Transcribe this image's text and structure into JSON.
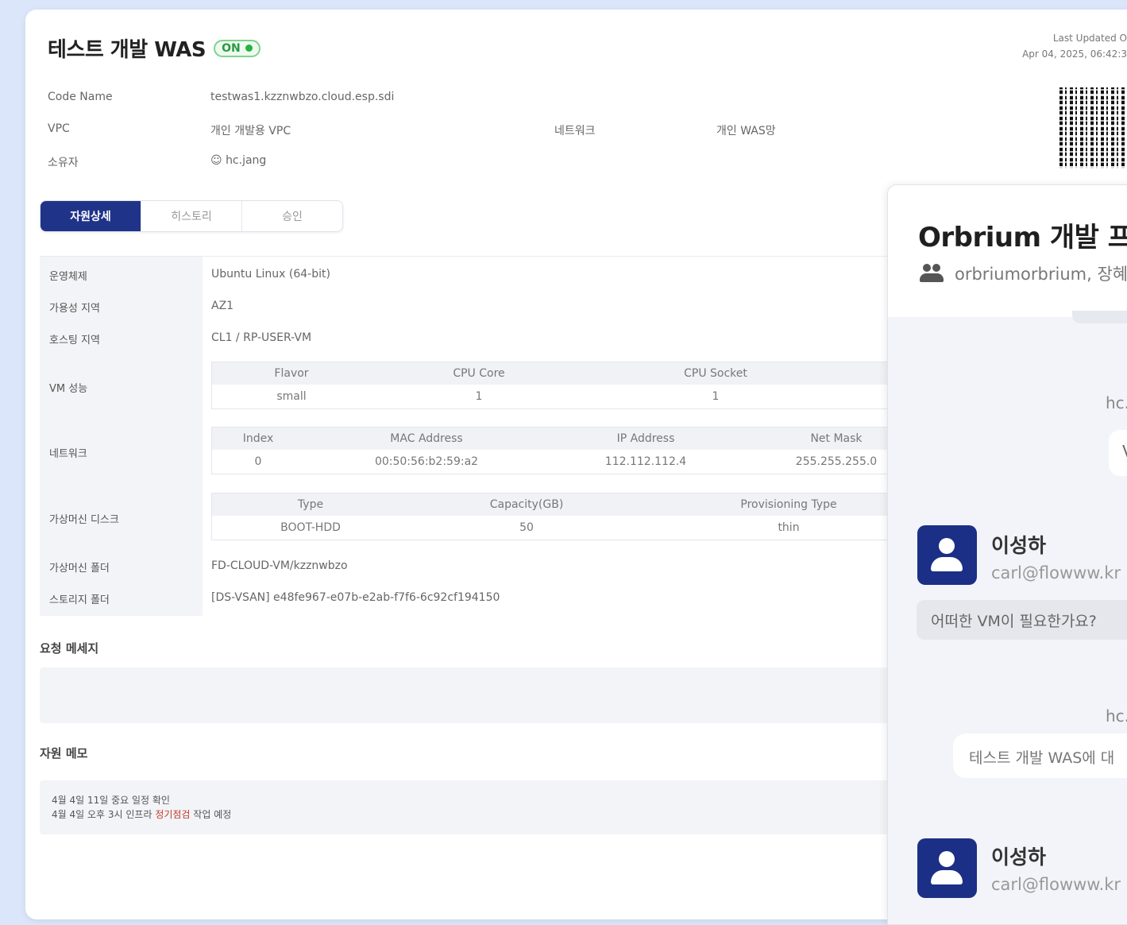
{
  "page": {
    "title": "테스트 개발 WAS",
    "status_badge": "ON",
    "last_updated_label": "Last Updated O",
    "last_updated_value": "Apr 04, 2025, 06:42:3"
  },
  "info": {
    "code_name_label": "Code Name",
    "code_name_value": "testwas1.kzznwbzo.cloud.esp.sdi",
    "vpc_label": "VPC",
    "vpc_value": "개인 개발용 VPC",
    "network_label": "네트워크",
    "network_value": "개인 WAS망",
    "owner_label": "소유자",
    "owner_value": "hc.jang"
  },
  "tabs": [
    "자원상세",
    "히스토리",
    "승인"
  ],
  "detail": {
    "os_label": "운영체제",
    "os_value": "Ubuntu Linux (64-bit)",
    "az_label": "가용성 지역",
    "az_value": "AZ1",
    "hosting_label": "호스팅 지역",
    "hosting_value": "CL1 / RP-USER-VM",
    "vm_spec_label": "VM 성능",
    "vm_spec": {
      "headers": [
        "Flavor",
        "CPU Core",
        "CPU Socket"
      ],
      "row": [
        "small",
        "1",
        "1"
      ]
    },
    "network_label": "네트워크",
    "network": {
      "headers": [
        "Index",
        "MAC Address",
        "IP Address",
        "Net Mask"
      ],
      "row": [
        "0",
        "00:50:56:b2:59:a2",
        "112.112.112.4",
        "255.255.255.0"
      ]
    },
    "disk_label": "가상머신 디스크",
    "disk": {
      "headers": [
        "Type",
        "Capacity(GB)",
        "Provisioning Type"
      ],
      "row": [
        "BOOT-HDD",
        "50",
        "thin"
      ]
    },
    "vm_folder_label": "가상머신 폴더",
    "vm_folder_value": "FD-CLOUD-VM/kzznwbzo",
    "storage_folder_label": "스토리지 폴더",
    "storage_folder_value": "[DS-VSAN] e48fe967-e07b-e2ab-f7f6-6c92cf194150"
  },
  "request_message": {
    "title": "요청 메세지",
    "content": ""
  },
  "resource_memo": {
    "title": "자원 메모",
    "line1": "4월 4일 11일 중요 일정 확인",
    "line2_prefix": "4월 4일 오후 3시 인프라 ",
    "line2_highlight": "정기점검",
    "line2_suffix": " 작업 예정"
  },
  "chat": {
    "title": "Orbrium 개발 프로",
    "members": "orbriumorbrium, 장혜",
    "messages": [
      {
        "sender_short": "hc.",
        "bubble_text": "V"
      },
      {
        "name": "이성하",
        "email": "carl@flowww.kr",
        "text": "어떠한 VM이 필요한가요?"
      },
      {
        "sender_short": "hc.",
        "bubble_text": "테스트 개발 WAS에 대"
      },
      {
        "name": "이성하",
        "email": "carl@flowww.kr"
      }
    ]
  },
  "colors": {
    "primary": "#1f3488",
    "status_green": "#26b33f",
    "avatar_bg": "#1c2f86",
    "background": "#dbe6fa"
  }
}
